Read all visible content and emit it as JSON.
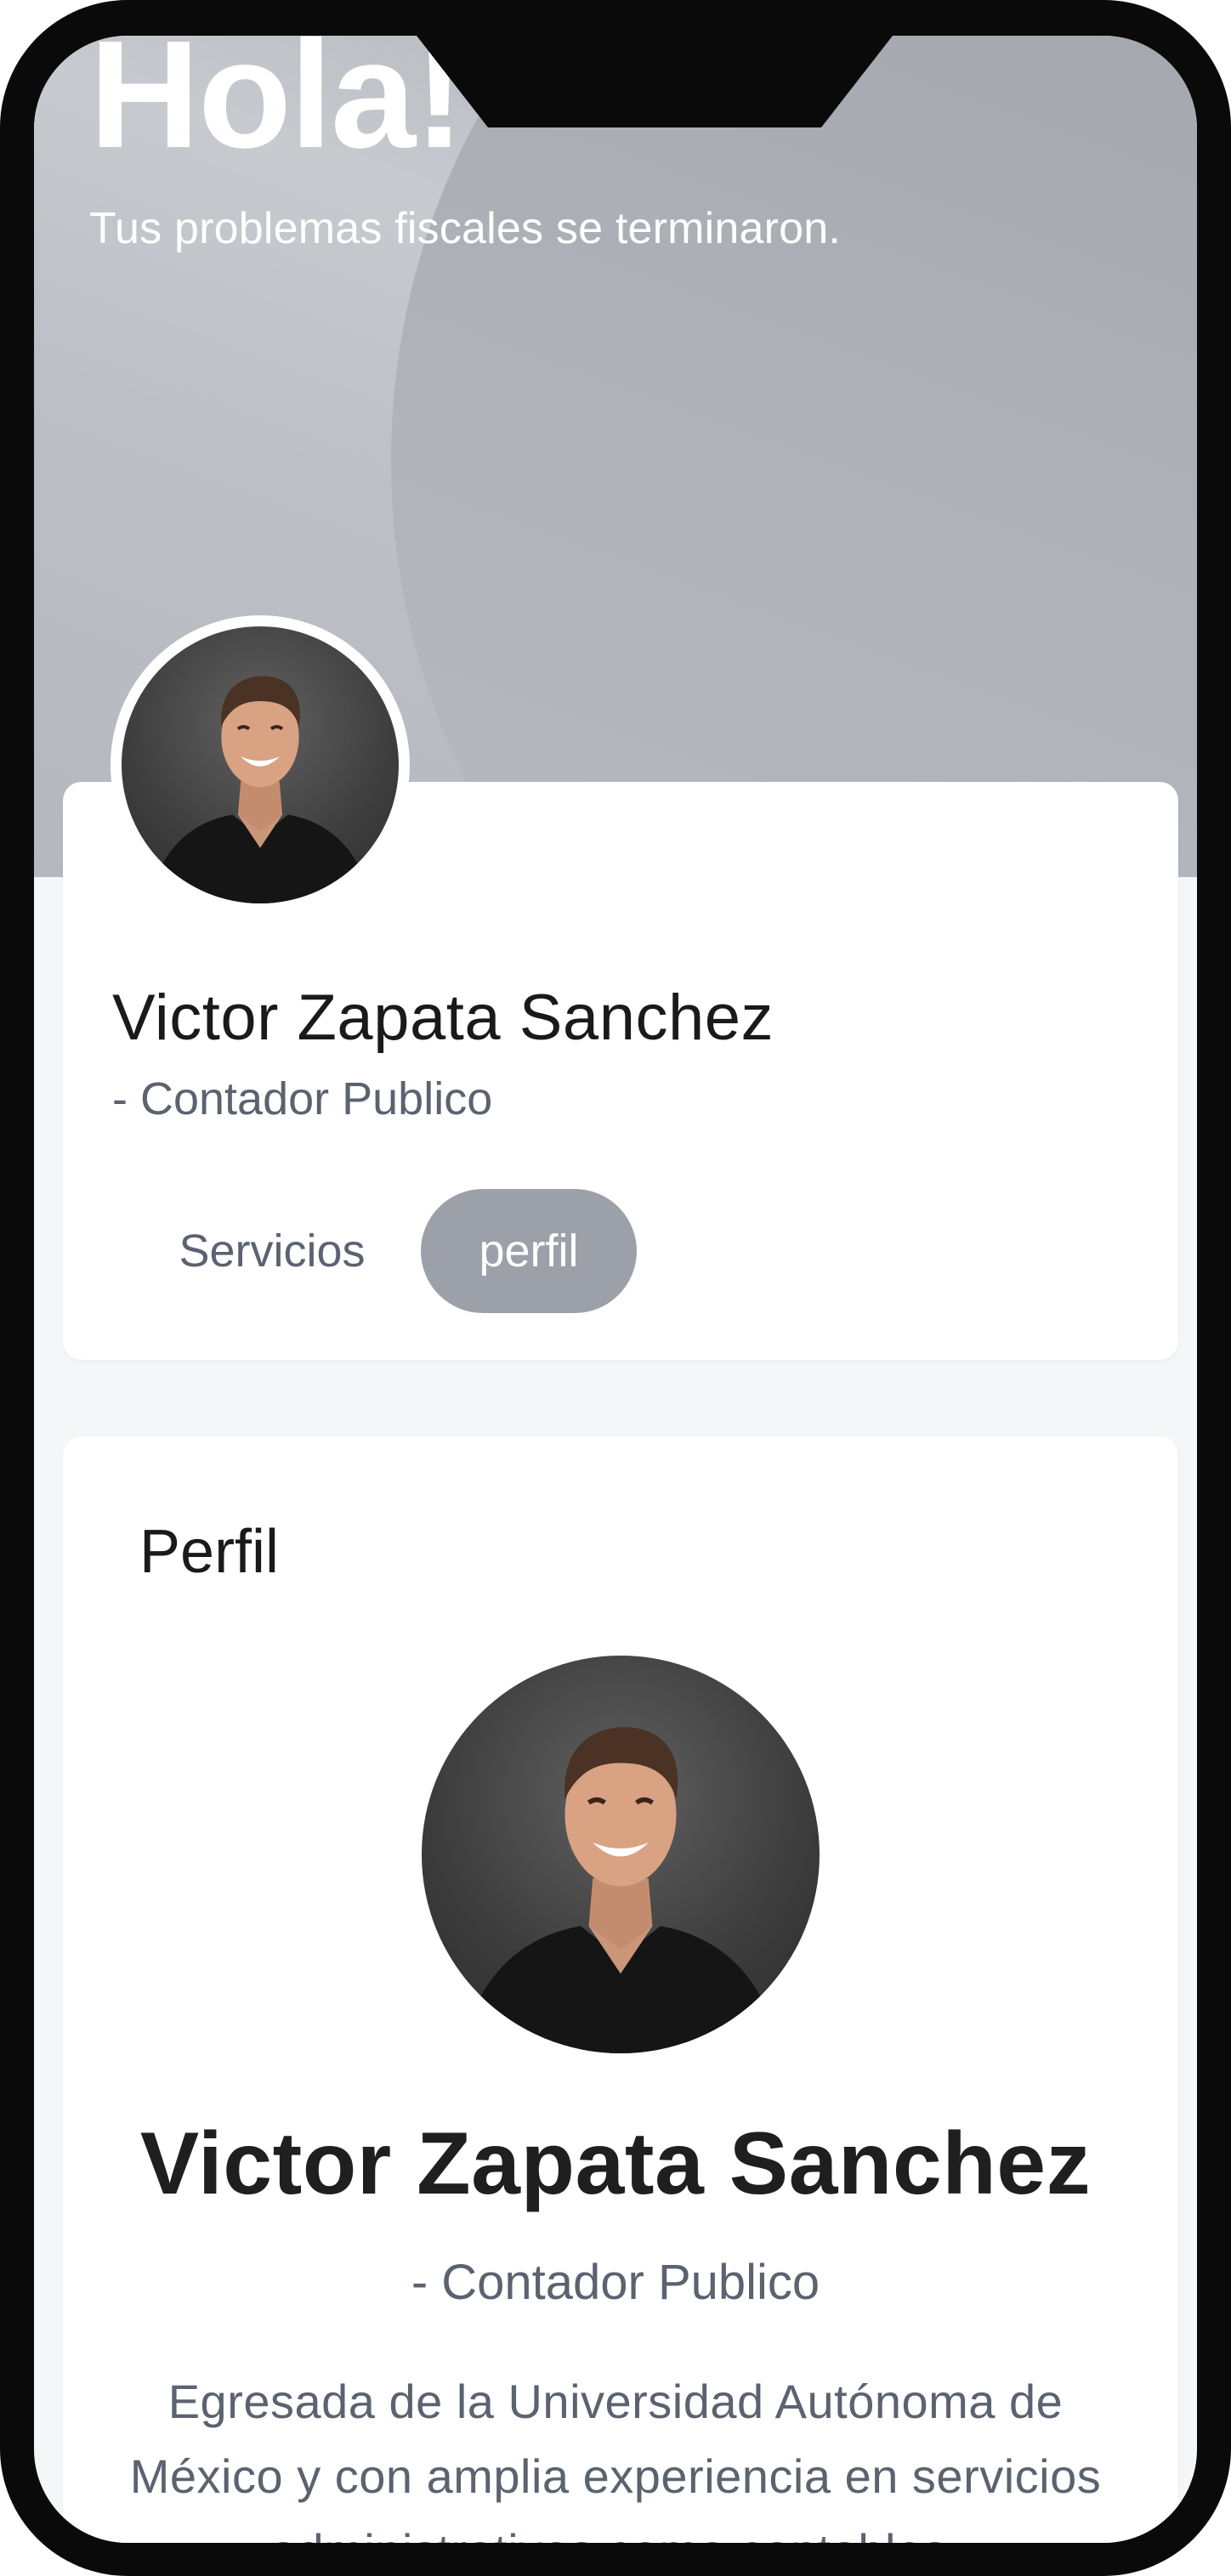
{
  "hero": {
    "title": "Hola!",
    "subtitle": "Tus problemas fiscales se terminaron."
  },
  "profile_card": {
    "avatar": "profile-photo",
    "name": "Victor Zapata Sanchez",
    "role": "- Contador Publico",
    "tabs": [
      {
        "label": "Servicios",
        "active": false
      },
      {
        "label": "perfil",
        "active": true
      }
    ]
  },
  "profile_section": {
    "title": "Perfil",
    "avatar": "profile-photo",
    "name": "Victor Zapata Sanchez",
    "role": "- Contador Publico",
    "bio": "Egresada de la Universidad Autónoma de México y con amplia experiencia en servicios administrativos como contables."
  },
  "colors": {
    "active_tab_bg": "#9ca0a8",
    "text_primary": "#1a1a1a",
    "text_secondary": "#5b6270",
    "hero_bg": "#bcc0c6"
  }
}
